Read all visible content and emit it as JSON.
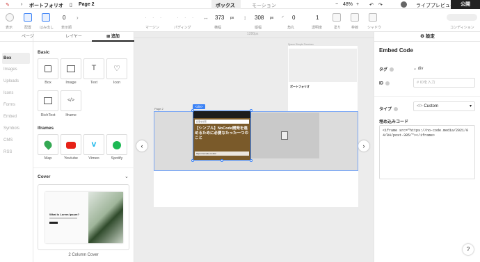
{
  "topbar": {
    "project": "ポートフォリオ",
    "page": "Page 2",
    "tab_box": "ボックス",
    "tab_motion": "モーション",
    "zoom": "48%",
    "preview_button": "ライブプレビュー",
    "publish_button": "公開"
  },
  "toolbar": {
    "labels": {
      "show": "表示",
      "align": "配置",
      "overflow": "はみ出し",
      "order": "表示順",
      "margin": "マージン",
      "padding": "パディング",
      "width": "横幅",
      "height": "縦幅",
      "radius": "角丸",
      "opacity": "透明度",
      "fill": "塗り",
      "border": "枠線",
      "shadow": "シャドウ",
      "condition": "コンディション"
    },
    "order_value": "0",
    "width_value": "373",
    "width_unit": "px",
    "height_value": "308",
    "height_unit": "px",
    "radius_value": "0",
    "opacity_value": "1"
  },
  "leftnav": [
    "Box",
    "Images",
    "Uploads",
    "Icons",
    "Forms",
    "Embed",
    "Symbols",
    "CMS",
    "RSS"
  ],
  "leftpanel": {
    "tabs": [
      "ページ",
      "レイヤー",
      "追加"
    ],
    "basic_title": "Basic",
    "basic": [
      "Box",
      "Image",
      "Text",
      "Icon",
      "RichText",
      "Iframe"
    ],
    "iframes_title": "Iframes",
    "iframes": [
      "Map",
      "Youtube",
      "Vimeo",
      "Spotify"
    ],
    "cover_title": "Cover",
    "cover_heading": "What is Lorem Ipsum?",
    "cover_label": "2 Column Cover"
  },
  "canvas": {
    "width_label": "1280px",
    "page_label": "Page 2",
    "div_badge": "<div>",
    "thumb_title": "【シンプル】NoCode開発を進めるために必要なたった一つのこと",
    "thumb_search": "記事を検索",
    "thumb_url": "https://nocode.media/",
    "preview_title": "ポートフォリオ",
    "preview_header": "Space Simple Premium"
  },
  "rightpanel": {
    "tab_settings": "設定",
    "title": "Embed Code",
    "tag_label": "タグ",
    "tag_value": "div",
    "id_label": "ID",
    "id_placeholder": "IDを入力",
    "type_label": "タイプ",
    "type_value": "Custom",
    "embed_label": "埋め込みコード",
    "embed_code": "<iframe src=\"https://no-code.media/2021/04/04/post-385/\"></iframe>",
    "help_button": "?"
  },
  "colors": {
    "accent": "#3b82f6",
    "topbar_dark": "#222222",
    "thumb": "#8a6d3b"
  }
}
